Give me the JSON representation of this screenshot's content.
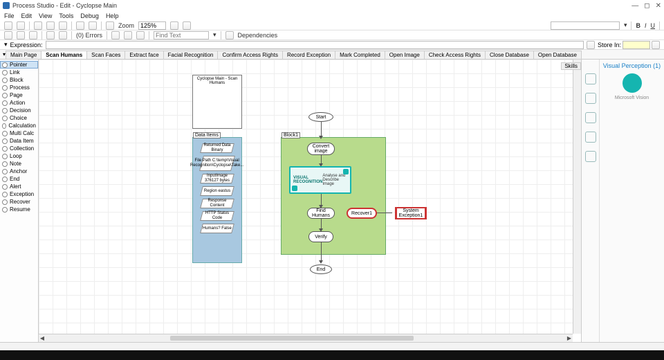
{
  "titlebar": {
    "title": "Process Studio - Edit - Cyclopse Main"
  },
  "menu": [
    "File",
    "Edit",
    "View",
    "Tools",
    "Debug",
    "Help"
  ],
  "toolbar1": {
    "zoom_label": "Zoom",
    "zoom_value": "125%"
  },
  "toolbar2": {
    "errors": "(0) Errors",
    "find_placeholder": "Find Text",
    "deps": "Dependencies"
  },
  "expr": {
    "label": "Expression:",
    "store_label": "Store In:"
  },
  "tabs": [
    "Main Page",
    "Scan Humans",
    "Scan Faces",
    "Extract face",
    "Facial Recognition",
    "Confirm Access Rights",
    "Record Exception",
    "Mark Completed",
    "Open Image",
    "Check Access Rights",
    "Close Database",
    "Open Database"
  ],
  "active_tab": 1,
  "palette": [
    "Pointer",
    "Link",
    "Block",
    "Process",
    "Page",
    "Action",
    "Decision",
    "Choice",
    "Calculation",
    "Multi Calc",
    "Data Item",
    "Collection",
    "Loop",
    "Note",
    "Anchor",
    "End",
    "Alert",
    "Exception",
    "Recover",
    "Resume"
  ],
  "palette_sel": 0,
  "canvas": {
    "info_title": "Cyclopse Main - Scan Humans",
    "block_label": "Block1",
    "datacol_label": "Data Items",
    "data_items": [
      "Returned Data Binary",
      "File Path C:\\temp\\Visual Recognition\\Cyclopse\\Take...",
      "InputImage 376127 bytes",
      "Region eastus",
      "Response Content",
      "HTTP Status Code",
      "Humans? False"
    ],
    "start": "Start",
    "convert": "Convert image",
    "vbo_title": "VISUAL RECOGNITION",
    "vbo_sub": "Analyse and Describe Image",
    "find": "Find Humans",
    "verify": "Verify",
    "recover": "Recover1",
    "sysex": "System Exception1",
    "end": "End"
  },
  "right": {
    "skills_tab": "Skills",
    "vp_title": "Visual Perception (1)",
    "vendor": "Microsoft Vision"
  }
}
